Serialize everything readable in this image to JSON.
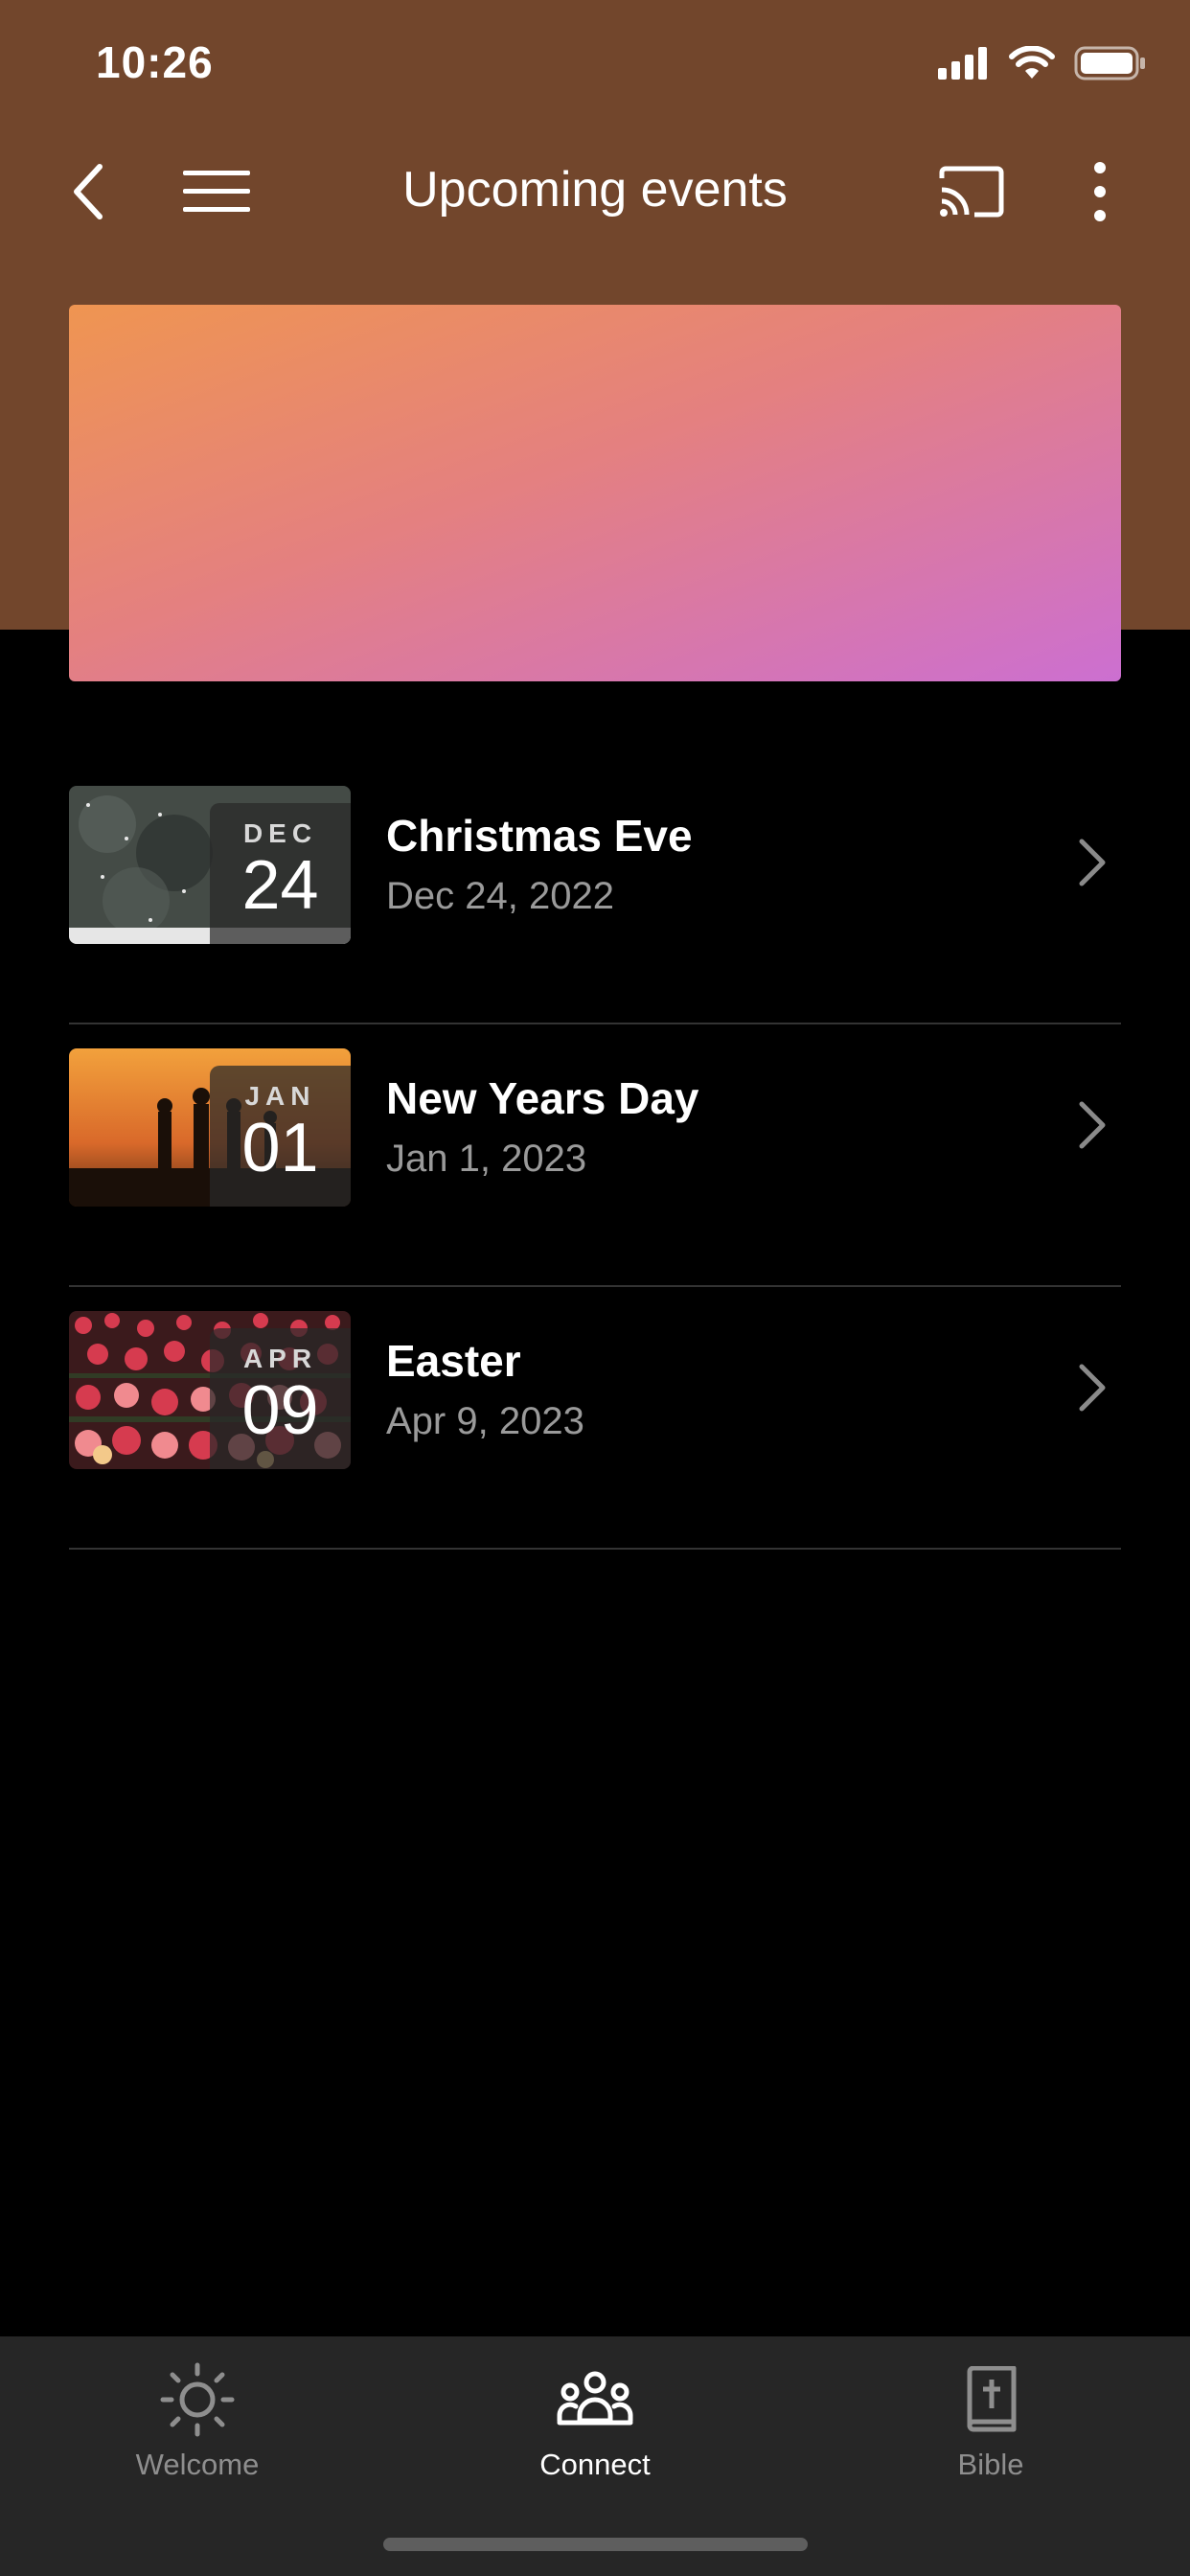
{
  "status_bar": {
    "time": "10:26",
    "icons": [
      "cellular-signal-icon",
      "wifi-icon",
      "battery-icon"
    ]
  },
  "nav": {
    "title": "Upcoming events",
    "icons": [
      "back-chevron-icon",
      "hamburger-menu-icon",
      "cast-icon",
      "more-vertical-icon"
    ]
  },
  "colors": {
    "header_bg": "#72462c",
    "banner_gradient": [
      "#ef9551",
      "#e48080",
      "#cc6fd1"
    ],
    "tab_bar_bg": "#262626"
  },
  "events": [
    {
      "month": "DEC",
      "day": "24",
      "title": "Christmas Eve",
      "date": "Dec 24, 2022",
      "thumbnail": "snowy-forest"
    },
    {
      "month": "JAN",
      "day": "01",
      "title": "New Years Day",
      "date": "Jan 1, 2023",
      "thumbnail": "sunset-silhouettes"
    },
    {
      "month": "APR",
      "day": "09",
      "title": "Easter",
      "date": "Apr 9, 2023",
      "thumbnail": "tulip-field"
    }
  ],
  "tabs": [
    {
      "label": "Welcome",
      "icon": "sun-icon",
      "active": false
    },
    {
      "label": "Connect",
      "icon": "people-group-icon",
      "active": true
    },
    {
      "label": "Bible",
      "icon": "bible-book-icon",
      "active": false
    }
  ]
}
